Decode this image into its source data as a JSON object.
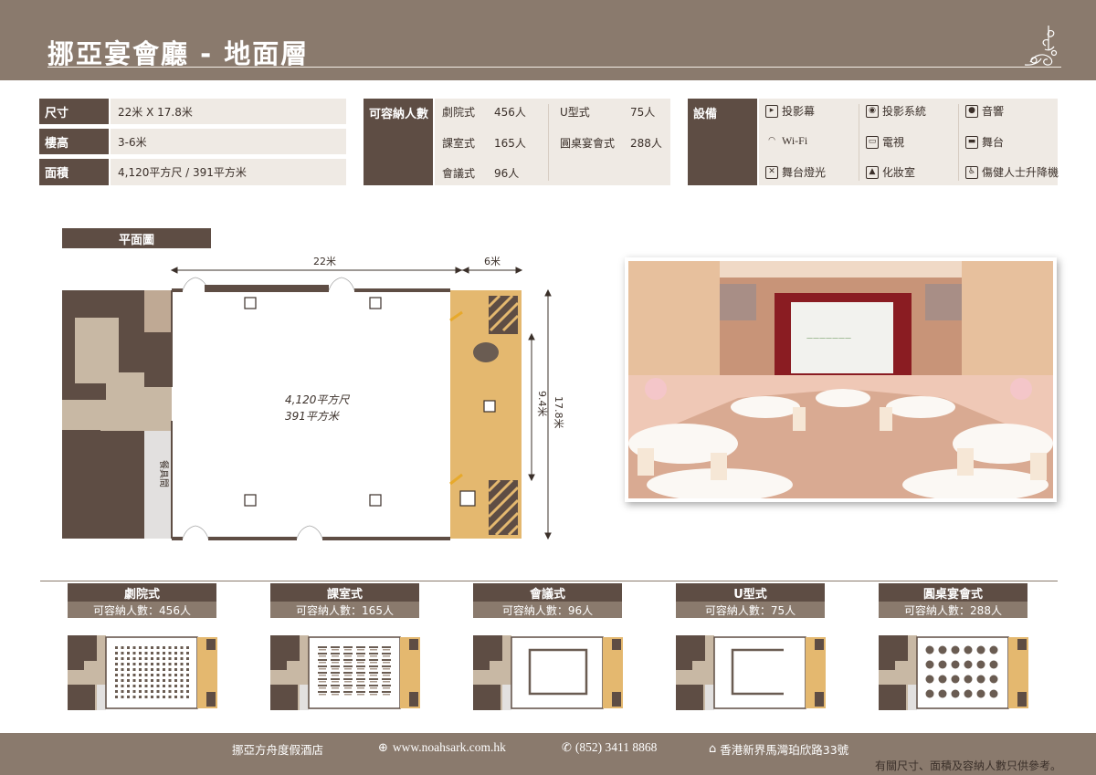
{
  "header": {
    "title": "挪亞宴會廳 - 地面層"
  },
  "info": {
    "rows": [
      {
        "label": "尺寸",
        "value": "22米 X 17.8米"
      },
      {
        "label": "樓高",
        "value": "3-6米"
      },
      {
        "label": "面積",
        "value": "4,120平方尺 / 391平方米"
      }
    ],
    "capacity_label": "可容納人數",
    "capacity": [
      {
        "name": "劇院式",
        "count": "456人"
      },
      {
        "name": "課室式",
        "count": "165人"
      },
      {
        "name": "會議式",
        "count": "96人"
      },
      {
        "name": "U型式",
        "count": "75人"
      },
      {
        "name": "圓桌宴會式",
        "count": "288人"
      }
    ],
    "equipment_label": "設備",
    "equipment": [
      {
        "name": "投影幕",
        "icon": "projector-screen-icon"
      },
      {
        "name": "投影系統",
        "icon": "projector-icon"
      },
      {
        "name": "音響",
        "icon": "speaker-icon"
      },
      {
        "name": "Wi-Fi",
        "icon": "wifi-icon"
      },
      {
        "name": "電視",
        "icon": "tv-icon"
      },
      {
        "name": "舞台",
        "icon": "stage-icon"
      },
      {
        "name": "舞台燈光",
        "icon": "stage-light-icon"
      },
      {
        "name": "化妝室",
        "icon": "dressing-room-icon"
      },
      {
        "name": "傷健人士升降機",
        "icon": "accessible-lift-icon"
      }
    ]
  },
  "floorplan": {
    "label": "平面圖",
    "dim_width": "22米",
    "dim_stage": "6米",
    "dim_length": "17.8米",
    "dim_stage_length": "9.4米",
    "area_sqft": "4,120平方尺",
    "area_sqm": "391平方米",
    "room_label": "餐具間"
  },
  "layouts": [
    {
      "name": "劇院式",
      "capacity": "可容納人數：456人"
    },
    {
      "name": "課室式",
      "capacity": "可容納人數：165人"
    },
    {
      "name": "會議式",
      "capacity": "可容納人數：96人"
    },
    {
      "name": "U型式",
      "capacity": "可容納人數：75人"
    },
    {
      "name": "圓桌宴會式",
      "capacity": "可容納人數：288人"
    }
  ],
  "footer": {
    "hotel": "挪亞方舟度假酒店",
    "website": "www.noahsark.com.hk",
    "phone": "(852) 3411 8868",
    "address": "香港新界馬灣珀欣路33號",
    "note": "有關尺寸、面積及容納人數只供參考。"
  },
  "colors": {
    "brand": "#8a7a6d",
    "dark": "#5e4d44",
    "light": "#efeae4",
    "stage": "#e4b86f"
  }
}
